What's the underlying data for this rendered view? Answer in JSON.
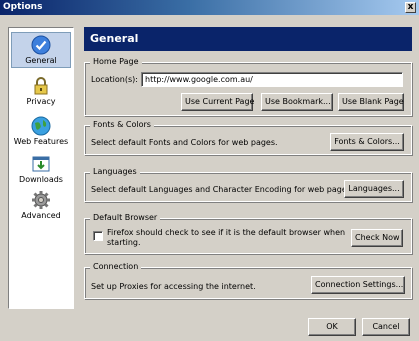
{
  "window": {
    "title": "Options",
    "close_glyph": "x"
  },
  "sidebar": {
    "items": [
      {
        "label": "General",
        "icon": "checkmark-icon",
        "selected": true
      },
      {
        "label": "Privacy",
        "icon": "lock-icon",
        "selected": false
      },
      {
        "label": "Web Features",
        "icon": "globe-icon",
        "selected": false
      },
      {
        "label": "Downloads",
        "icon": "downloads-icon",
        "selected": false
      },
      {
        "label": "Advanced",
        "icon": "gear-icon",
        "selected": false
      }
    ]
  },
  "main": {
    "title": "General",
    "home_page": {
      "legend": "Home Page",
      "location_label": "Location(s):",
      "location_value": "http://www.google.com.au/",
      "use_current_label": "Use Current Page",
      "use_bookmark_label": "Use Bookmark...",
      "use_blank_label": "Use Blank Page"
    },
    "fonts_colors": {
      "legend": "Fonts & Colors",
      "description": "Select default Fonts and Colors for web pages.",
      "button_label": "Fonts & Colors..."
    },
    "languages": {
      "legend": "Languages",
      "description": "Select default Languages and Character Encoding for web pages.",
      "button_label": "Languages..."
    },
    "default_browser": {
      "legend": "Default Browser",
      "checkbox_line1": "Firefox should check to see if it is the default browser when",
      "checkbox_line2": "starting.",
      "checked": false,
      "button_label": "Check Now"
    },
    "connection": {
      "legend": "Connection",
      "description": "Set up Proxies for accessing the internet.",
      "button_label": "Connection Settings..."
    }
  },
  "footer": {
    "ok_label": "OK",
    "cancel_label": "Cancel"
  },
  "colors": {
    "accent": "#0a246a",
    "face": "#d4d0c8",
    "selected": "#c4d3ea"
  }
}
